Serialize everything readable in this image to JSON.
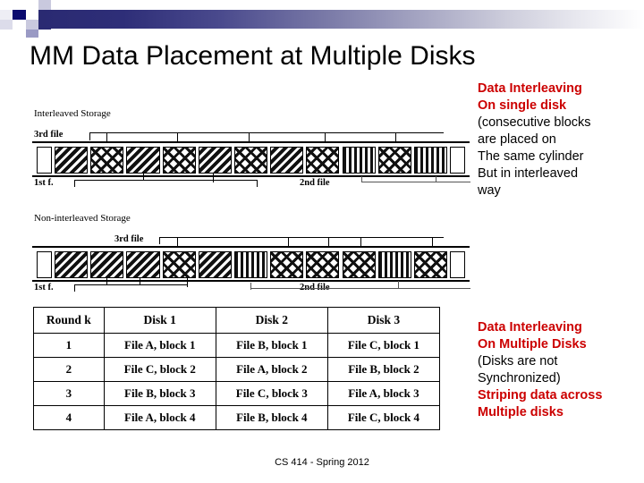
{
  "slide": {
    "title": "MM Data Placement at Multiple Disks",
    "footer": "CS 414 - Spring 2012",
    "accent_red": "#cc0000",
    "header_gradient_from": "#2a2a72",
    "header_gradient_to": "#ffffff"
  },
  "diagram_interleaved": {
    "caption": "Interleaved Storage",
    "top_label": "3rd file",
    "bottom_left_label": "1st f.",
    "bottom_right_label": "2nd file",
    "blocks": [
      {
        "pattern": "empty"
      },
      {
        "pattern": "diagonal"
      },
      {
        "pattern": "crosshatch"
      },
      {
        "pattern": "diagonal"
      },
      {
        "pattern": "crosshatch"
      },
      {
        "pattern": "diagonal"
      },
      {
        "pattern": "crosshatch"
      },
      {
        "pattern": "diagonal"
      },
      {
        "pattern": "crosshatch"
      },
      {
        "pattern": "vertical"
      },
      {
        "pattern": "crosshatch"
      },
      {
        "pattern": "vertical"
      },
      {
        "pattern": "empty"
      }
    ]
  },
  "diagram_non_interleaved": {
    "caption": "Non-interleaved Storage",
    "top_label": "3rd file",
    "bottom_left_label": "1st f.",
    "bottom_right_label": "2nd file",
    "blocks": [
      {
        "pattern": "empty"
      },
      {
        "pattern": "diagonal"
      },
      {
        "pattern": "diagonal"
      },
      {
        "pattern": "diagonal"
      },
      {
        "pattern": "crosshatch"
      },
      {
        "pattern": "diagonal"
      },
      {
        "pattern": "vertical"
      },
      {
        "pattern": "crosshatch"
      },
      {
        "pattern": "crosshatch"
      },
      {
        "pattern": "crosshatch"
      },
      {
        "pattern": "vertical"
      },
      {
        "pattern": "crosshatch"
      },
      {
        "pattern": "empty"
      }
    ]
  },
  "table": {
    "headers": [
      "Round k",
      "Disk 1",
      "Disk 2",
      "Disk 3"
    ],
    "rows": [
      [
        "1",
        "File A, block 1",
        "File B, block 1",
        "File C, block 1"
      ],
      [
        "2",
        "File C, block 2",
        "File A, block 2",
        "File B, block 2"
      ],
      [
        "3",
        "File B, block 3",
        "File C, block 3",
        "File A, block 3"
      ],
      [
        "4",
        "File A, block 4",
        "File B, block 4",
        "File C, block 4"
      ]
    ]
  },
  "annotation_top": {
    "lines": [
      {
        "text": "Data Interleaving",
        "style": "red"
      },
      {
        "text": "On single disk",
        "style": "red"
      },
      {
        "text": "(consecutive blocks",
        "style": "black"
      },
      {
        "text": "are placed on",
        "style": "black"
      },
      {
        "text": "The same cylinder",
        "style": "black"
      },
      {
        "text": "But in interleaved",
        "style": "black"
      },
      {
        "text": "way",
        "style": "black"
      }
    ]
  },
  "annotation_bottom": {
    "lines": [
      {
        "text": "Data Interleaving",
        "style": "red"
      },
      {
        "text": "On Multiple Disks",
        "style": "red"
      },
      {
        "text": "(Disks are not",
        "style": "black"
      },
      {
        "text": "Synchronized)",
        "style": "black"
      },
      {
        "text": "Striping data across",
        "style": "red"
      },
      {
        "text": "Multiple disks",
        "style": "red"
      }
    ]
  }
}
